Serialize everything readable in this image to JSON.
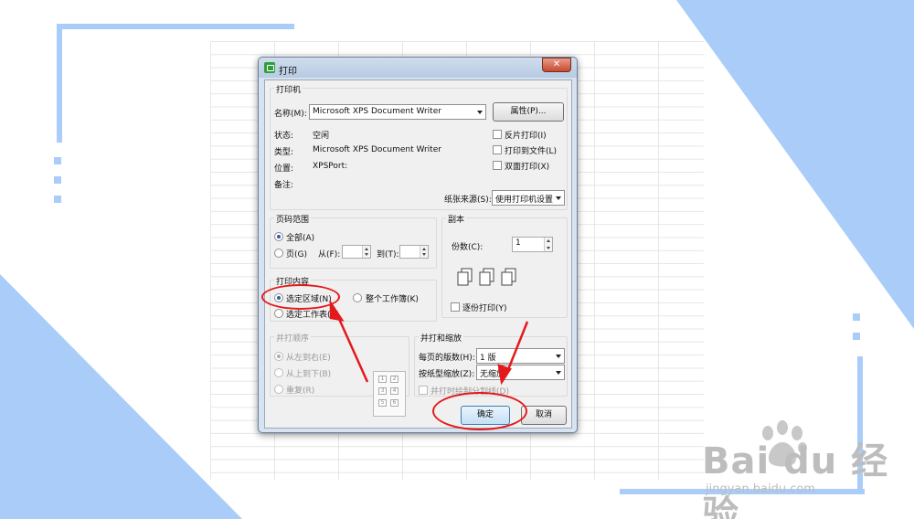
{
  "dialog": {
    "title": "打印",
    "close_glyph": "✕",
    "printer_group": {
      "legend": "打印机",
      "name_label": "名称(M):",
      "name_value": "Microsoft XPS Document Writer",
      "properties_button": "属性(P)...",
      "status_label": "状态:",
      "status_value": "空闲",
      "type_label": "类型:",
      "type_value": "Microsoft XPS Document Writer",
      "location_label": "位置:",
      "location_value": "XPSPort:",
      "comment_label": "备注:",
      "reverse_print": "反片打印(I)",
      "print_to_file": "打印到文件(L)",
      "duplex_print": "双面打印(X)",
      "paper_source_label": "纸张来源(S):",
      "paper_source_value": "使用打印机设置"
    },
    "page_range": {
      "legend": "页码范围",
      "all": "全部(A)",
      "pages": "页(G)",
      "from": "从(F):",
      "to": "到(T):",
      "from_value": "",
      "to_value": ""
    },
    "copies": {
      "legend": "副本",
      "count_label": "份数(C):",
      "count_value": "1",
      "collate": "逐份打印(Y)"
    },
    "print_content": {
      "legend": "打印内容",
      "selection": "选定区域(N)",
      "workbook": "整个工作簿(K)",
      "sheets": "选定工作表(V)"
    },
    "print_order": {
      "legend": "并打顺序",
      "left_to_right": "从左到右(E)",
      "top_to_bottom": "从上到下(B)",
      "repeat": "重复(R)",
      "grid": [
        "1",
        "2",
        "3",
        "4",
        "5",
        "6"
      ]
    },
    "scaling": {
      "legend": "并打和缩放",
      "pages_per_sheet_label": "每页的版数(H):",
      "pages_per_sheet_value": "1 版",
      "scale_to_paper_label": "按纸型缩放(Z):",
      "scale_to_paper_value": "无缩放",
      "draw_border": "并打时绘制分割线(D)"
    },
    "ok_button": "确定",
    "cancel_button": "取消"
  },
  "watermark": {
    "logo": "Bai du 经验",
    "url": "jingyan.baidu.com"
  },
  "colors": {
    "accent_blue": "#a9cdf8",
    "annotation_red": "#e3191c",
    "dialog_frame": "#d7e3f1"
  }
}
